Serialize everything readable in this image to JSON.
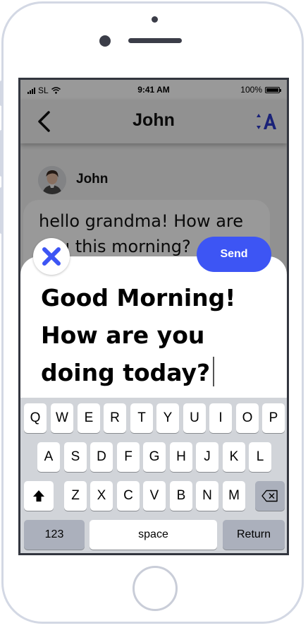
{
  "status_bar": {
    "carrier": "SL",
    "time": "9:41 AM",
    "battery": "100%"
  },
  "header": {
    "title": "John",
    "back_icon": "chevron-left-icon",
    "text_size_icon": "text-size-icon"
  },
  "conversation": {
    "sender_name": "John",
    "message": "hello grandma! How are you this morning?"
  },
  "compose": {
    "text": "Good Morning! How are you doing today?",
    "send_label": "Send",
    "close_icon": "close-icon"
  },
  "keyboard": {
    "row1": [
      "Q",
      "W",
      "E",
      "R",
      "T",
      "Y",
      "U",
      "I",
      "O",
      "P"
    ],
    "row2": [
      "A",
      "S",
      "D",
      "F",
      "G",
      "H",
      "J",
      "K",
      "L"
    ],
    "row3": [
      "Z",
      "X",
      "C",
      "V",
      "B",
      "N",
      "M"
    ],
    "numbers_label": "123",
    "space_label": "space",
    "return_label": "Return"
  },
  "colors": {
    "accent": "#3d55f4",
    "close_x": "#3d55f4",
    "keyboard_bg": "#d1d4d9"
  }
}
